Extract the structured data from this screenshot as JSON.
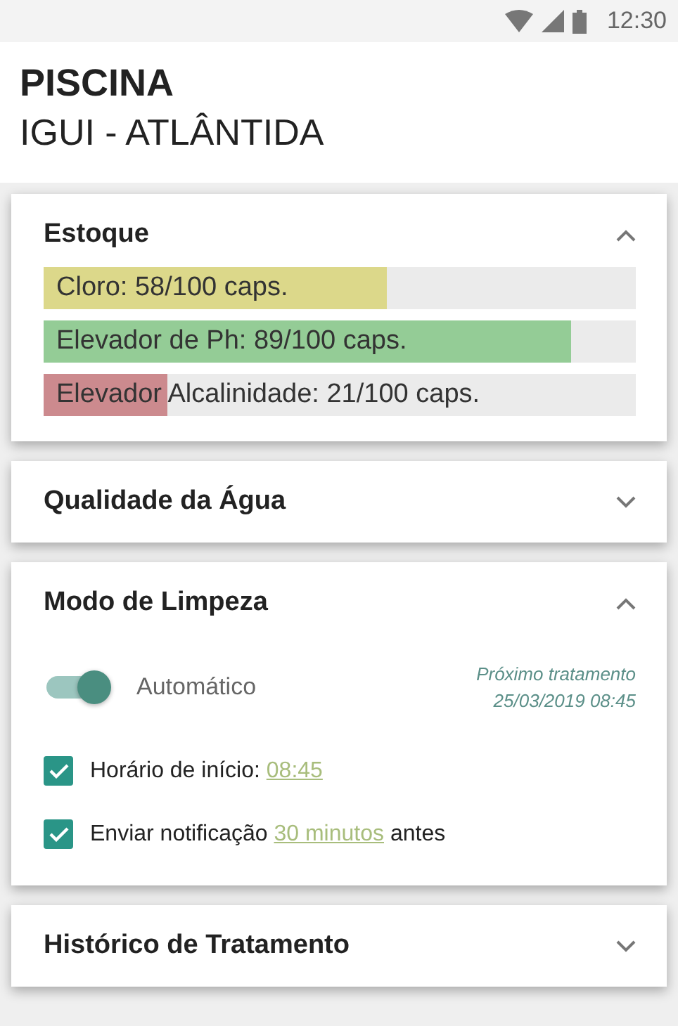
{
  "status_bar": {
    "time": "12:30"
  },
  "header": {
    "title": "PISCINA",
    "subtitle": "IGUI - ATLÂNTIDA"
  },
  "sections": [
    {
      "kind": "stock",
      "title": "Estoque",
      "expanded": true,
      "items": [
        {
          "label": "Cloro: 58/100 caps.",
          "level": 0.58,
          "color": "#dcd88a"
        },
        {
          "label": "Elevador de Ph: 89/100 caps.",
          "level": 0.89,
          "color": "#94cc96"
        },
        {
          "label": "Elevador Alcalinidade: 21/100 caps.",
          "level": 0.21,
          "color": "#cc8a8e"
        }
      ]
    },
    {
      "title": "Qualidade da Água",
      "expanded": false
    },
    {
      "kind": "cleaning",
      "title": "Modo de Limpeza",
      "expanded": true,
      "toggle": {
        "label": "Automático",
        "on": true
      },
      "next": {
        "label": "Próximo tratamento",
        "value": "25/03/2019 08:45"
      },
      "options": [
        {
          "checked": true,
          "before": "Horário de início: ",
          "link": "08:45"
        },
        {
          "checked": true,
          "before": "Enviar notificação ",
          "link": "30 minutos",
          "after": " antes"
        }
      ]
    },
    {
      "title": "Histórico de Tratamento",
      "expanded": false
    }
  ]
}
